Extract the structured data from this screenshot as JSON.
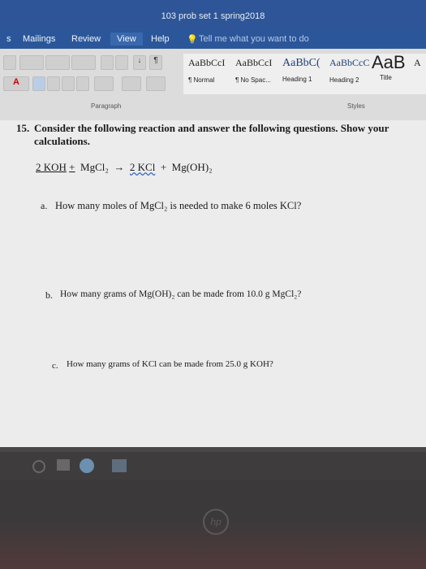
{
  "window": {
    "title": "103 prob set 1 spring2018"
  },
  "tabs": [
    {
      "label": "s"
    },
    {
      "label": "Mailings"
    },
    {
      "label": "Review"
    },
    {
      "label": "View"
    },
    {
      "label": "Help"
    }
  ],
  "tell_me": {
    "placeholder": "Tell me what you want to do"
  },
  "styles": [
    {
      "preview": "AaBbCcI",
      "name": "¶ Normal"
    },
    {
      "preview": "AaBbCcI",
      "name": "¶ No Spac..."
    },
    {
      "preview": "AaBbC(",
      "name": "Heading 1"
    },
    {
      "preview": "AaBbCcC",
      "name": "Heading 2"
    },
    {
      "preview": "AaB",
      "name": "Title"
    },
    {
      "preview": "A",
      "name": ""
    }
  ],
  "groups": {
    "paragraph": "Paragraph",
    "styles": "Styles"
  },
  "document": {
    "q_number": "15.",
    "q_line1": "Consider the following reaction and answer the following questions.  Show your",
    "q_line2": "calculations.",
    "eq_koh": "2 KOH",
    "eq_plus1": "+",
    "eq_mgcl2": "MgCl₂",
    "eq_arrow": "→",
    "eq_kcl": "2 KCl",
    "eq_plus2": "+",
    "eq_mgoh2": "Mg(OH)₂",
    "a_label": "a.",
    "a_text": "How many moles of MgCl₂ is needed to make 6 moles KCl?",
    "b_label": "b.",
    "b_text": "How many grams of Mg(OH)₂ can be made from 10.0 g MgCl₂?",
    "c_label": "c.",
    "c_text": "How many grams of KCl can be made from 25.0 g KOH?"
  },
  "colors": {
    "title_bar": "#2e5597",
    "ribbon": "#dcdcdc",
    "page": "#ececec",
    "taskbar": "#3e3c3d"
  },
  "icons": [
    "bullets-icon",
    "numbering-icon",
    "multilevel-list-icon",
    "decrease-indent-icon",
    "increase-indent-icon",
    "sort-icon",
    "pilcrow-icon",
    "font-color-icon",
    "align-left-icon",
    "center-icon",
    "align-right-icon",
    "justify-icon",
    "line-spacing-icon",
    "shading-icon",
    "borders-icon",
    "search-icon",
    "windows-icon",
    "taskview-icon",
    "chrome-icon",
    "hp-logo-icon"
  ]
}
